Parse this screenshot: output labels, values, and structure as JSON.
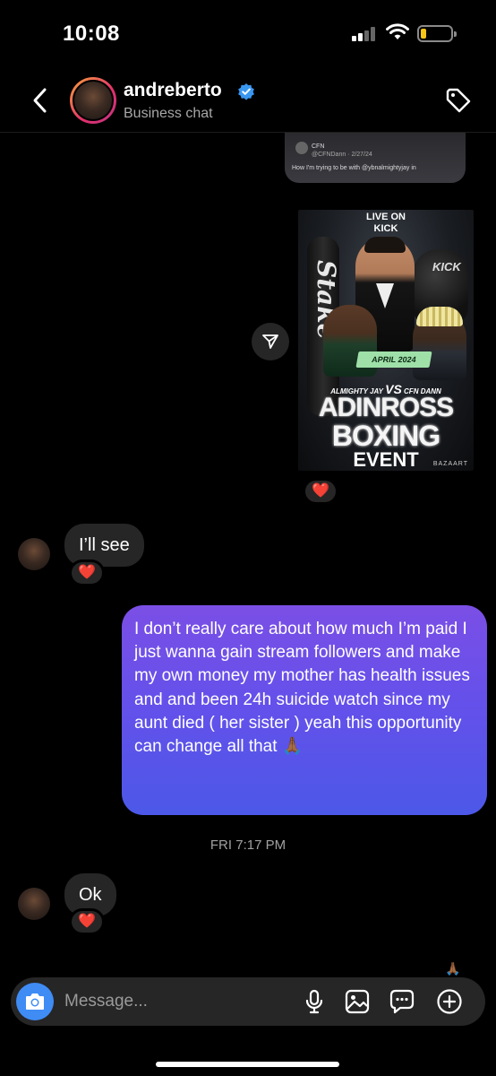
{
  "status_bar": {
    "time": "10:08"
  },
  "header": {
    "username": "andreberto",
    "subtitle": "Business chat",
    "verified": true,
    "icons": [
      "back-chevron-icon",
      "verified-badge-icon",
      "tag-icon"
    ]
  },
  "shared_post_top": {
    "handle": "CFN",
    "meta": "@CFNDann · 2/27/24",
    "caption": "How I'm trying to be with @ybnalmightyjay in"
  },
  "poster": {
    "live_line1": "LIVE ON",
    "live_line2": "KICK",
    "sponsor": "Stake",
    "platform": "KICK",
    "date": "APRIL 2024",
    "fighter_left": "ALMIGHTY JAY",
    "vs": "VS",
    "fighter_right": "CFN DANN",
    "title_1": "ADINROSS",
    "title_2": "BOXING",
    "title_3": "EVENT",
    "watermark": "BAZAART",
    "reaction": "❤️"
  },
  "messages": [
    {
      "from": "them",
      "text": "I’ll see",
      "reaction": "❤️"
    },
    {
      "from": "me",
      "text": "I don’t really care about how much I’m paid I just wanna gain stream followers and make my own money my mother has health issues and and been 24h suicide watch since my aunt died ( her sister ) yeah this opportunity can change all that 🙏🏾"
    },
    {
      "from": "them",
      "text": "Ok",
      "reaction": "❤️"
    }
  ],
  "timestamp": "FRI 7:17 PM",
  "trailing_emoji": "🙏🏾",
  "composer": {
    "placeholder": "Message...",
    "icons": [
      "camera-icon",
      "microphone-icon",
      "gallery-icon",
      "sticker-icon",
      "plus-icon"
    ]
  },
  "colors": {
    "background": "#000000",
    "incoming_bubble": "#262626",
    "outgoing_gradient_top": "#7b4fe6",
    "outgoing_gradient_bottom": "#4c58e8",
    "camera_button": "#3f8cf5",
    "verified": "#3897f0",
    "battery": "#f5c518"
  }
}
